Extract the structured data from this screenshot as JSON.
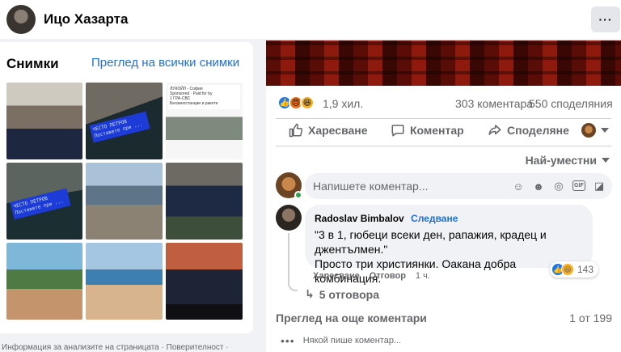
{
  "header": {
    "page_name": "Ицо Хазарта",
    "more_label": "···"
  },
  "photos": {
    "title": "Снимки",
    "see_all": "Преглед на всички снимки",
    "lcd_text": "ЧЕСТО ПЕТРОВ\nПоставете при ...",
    "ad_text": "ЛУКОЙЛ - София\nSponsored · Paid for by\n1 ГРА-СВС\nБензиностанции и ракети"
  },
  "footer": {
    "links": "Информация за анализите на страницата · Поверителност ·"
  },
  "post": {
    "reaction_count": "1,9 хил.",
    "comments_count": "303 коментара",
    "shares_count": "550 споделяния",
    "actions": {
      "like": "Харесване",
      "comment": "Коментар",
      "share": "Споделяне"
    },
    "sort_label": "Най-уместни",
    "composer_placeholder": "Напишете коментар...",
    "comment": {
      "author": "Radoslav Bimbalov",
      "follow": "Следване",
      "text": "\"3 в 1, гюбеци всеки ден, рапажия, крадец и джентълмен.\"\nПросто три християнки. Оакана добра комбинация.",
      "reaction_count": "143",
      "like": "Харесване",
      "reply": "Отговор",
      "time": "1 ч.",
      "replies": "5 отговора"
    },
    "more_comments": "Преглед на още коментари",
    "pager": "1 от 199",
    "typing": "Някой пише коментар..."
  },
  "colors": {
    "accent": "#216fdb",
    "like_blue": "#1877f2",
    "muted": "#65676b",
    "bg": "#f0f2f5"
  }
}
